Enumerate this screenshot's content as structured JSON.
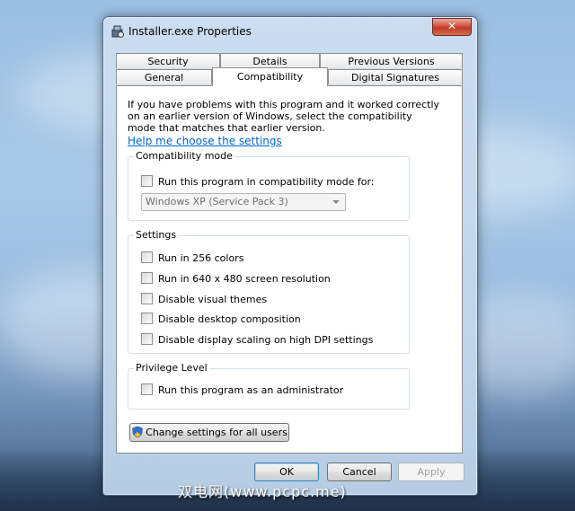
{
  "window": {
    "title": "Installer.exe Properties",
    "close_glyph": "✕"
  },
  "tabs_row1": [
    {
      "label": "Security"
    },
    {
      "label": "Details"
    },
    {
      "label": "Previous Versions"
    }
  ],
  "tabs_row2": [
    {
      "label": "General"
    },
    {
      "label": "Compatibility",
      "active": true
    },
    {
      "label": "Digital Signatures"
    }
  ],
  "intro_text": "If you have problems with this program and it worked correctly on an earlier version of Windows, select the compatibility mode that matches that earlier version.",
  "help_link": "Help me choose the settings",
  "compat_mode": {
    "label": "Compatibility mode",
    "checkbox_label": "Run this program in compatibility mode for:",
    "checked": false,
    "selected_os": "Windows XP (Service Pack 3)"
  },
  "settings": {
    "label": "Settings",
    "options": [
      {
        "label": "Run in 256 colors",
        "checked": false
      },
      {
        "label": "Run in 640 x 480 screen resolution",
        "checked": false
      },
      {
        "label": "Disable visual themes",
        "checked": false
      },
      {
        "label": "Disable desktop composition",
        "checked": false
      },
      {
        "label": "Disable display scaling on high DPI settings",
        "checked": false
      }
    ]
  },
  "privilege": {
    "label": "Privilege Level",
    "checkbox_label": "Run this program as an administrator",
    "checked": false
  },
  "change_all_users_label": "Change settings for all users",
  "buttons": {
    "ok": "OK",
    "cancel": "Cancel",
    "apply": "Apply"
  },
  "watermark": "双电网(www.pcpc.me)",
  "icons": {
    "app": "installer-icon",
    "uac": "uac-shield-icon",
    "dropdown": "chevron-down-icon"
  },
  "colors": {
    "link": "#0066cc",
    "close_button": "#c03a25",
    "default_button_border": "#3c7fb1"
  }
}
